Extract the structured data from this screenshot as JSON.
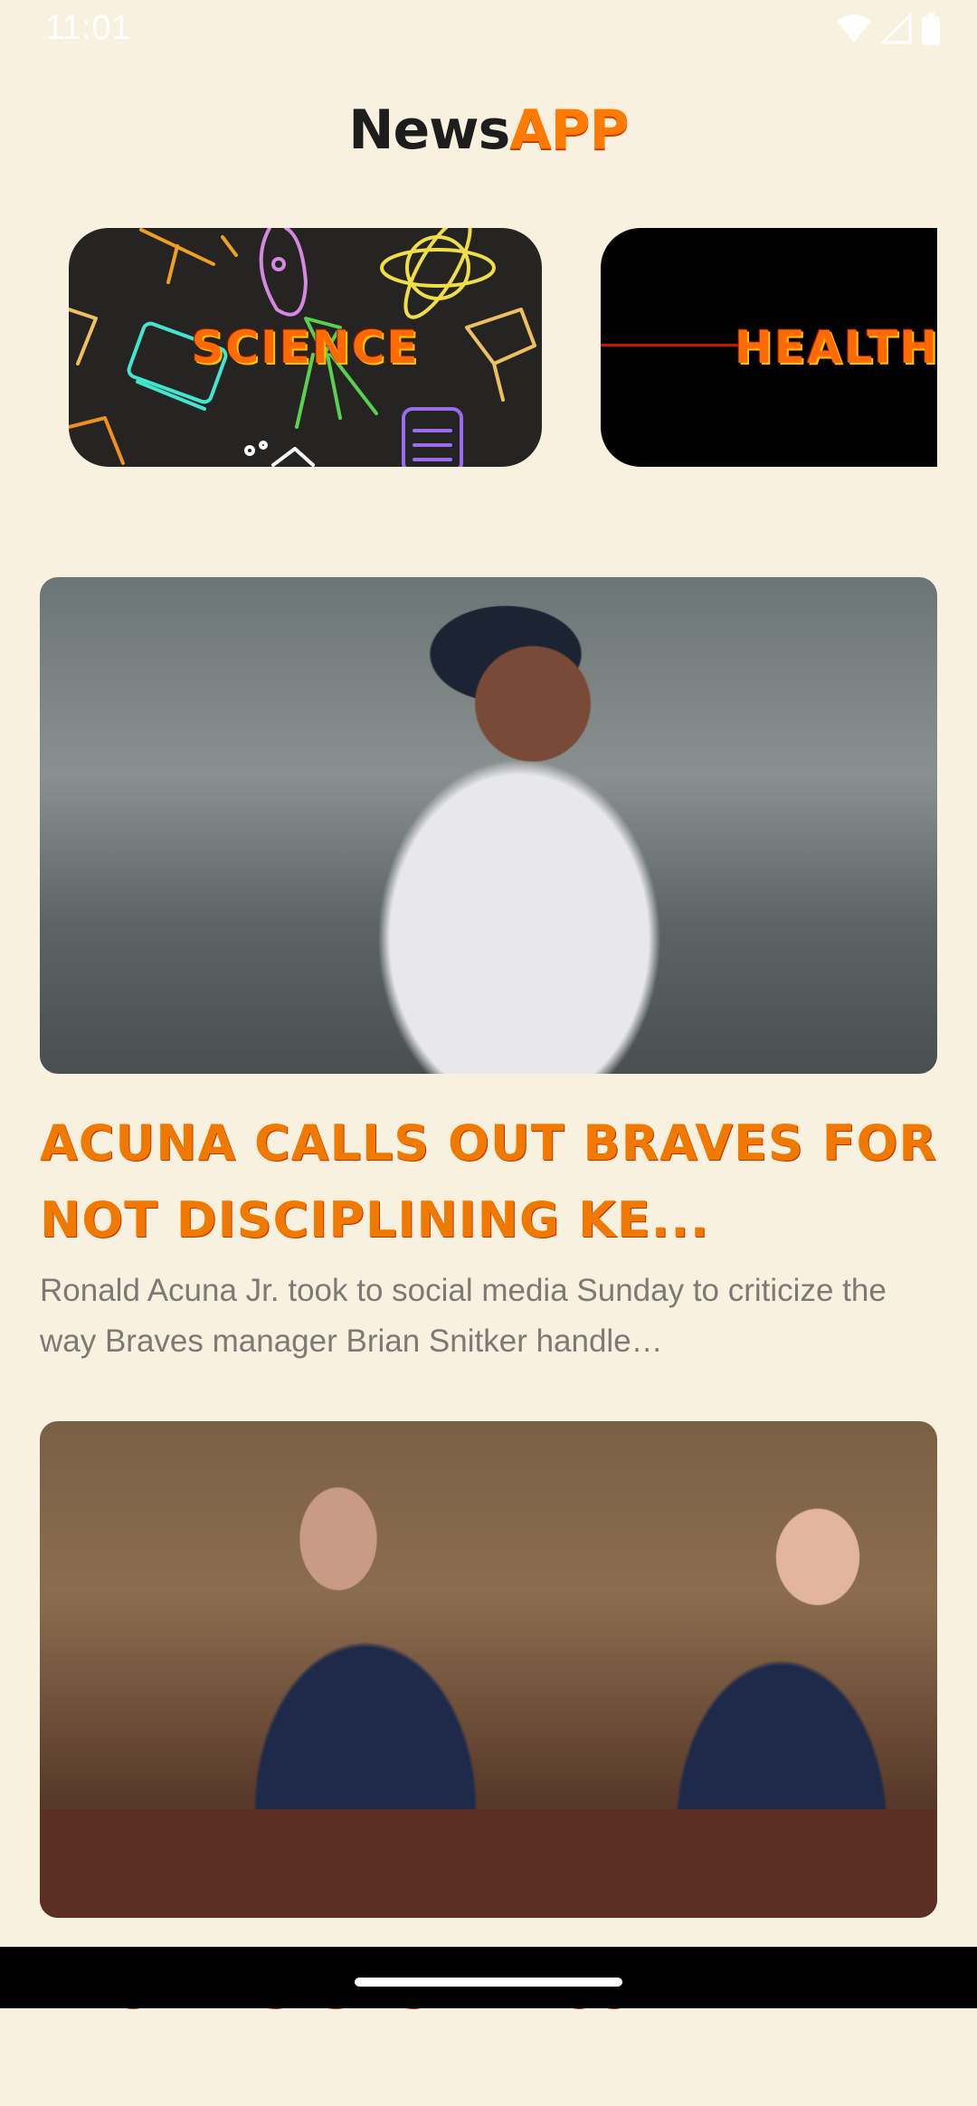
{
  "status_bar": {
    "time": "11:01",
    "icons": [
      "wifi-icon",
      "signal-icon",
      "battery-icon"
    ]
  },
  "header": {
    "title_part1": "News",
    "title_part2": "APP"
  },
  "categories": [
    {
      "label": "SCIENCE",
      "background": "#252423"
    },
    {
      "label": "HEALTH",
      "background": "#000000"
    }
  ],
  "articles": [
    {
      "title": "ACUNA CALLS OUT BRAVES FOR NOT DISCIPLINING KE...",
      "description": "Ronald Acuna Jr. took to social media Sunday to criticize the way Braves manager Brian Snitker handle…"
    },
    {
      "title": "TRUMP SIGNS EXECUTIVE"
    }
  ],
  "colors": {
    "background": "#f9f1df",
    "accent": "#ff7a00",
    "title_dark": "#1d1d1d",
    "desc_text": "#7d7a76"
  }
}
